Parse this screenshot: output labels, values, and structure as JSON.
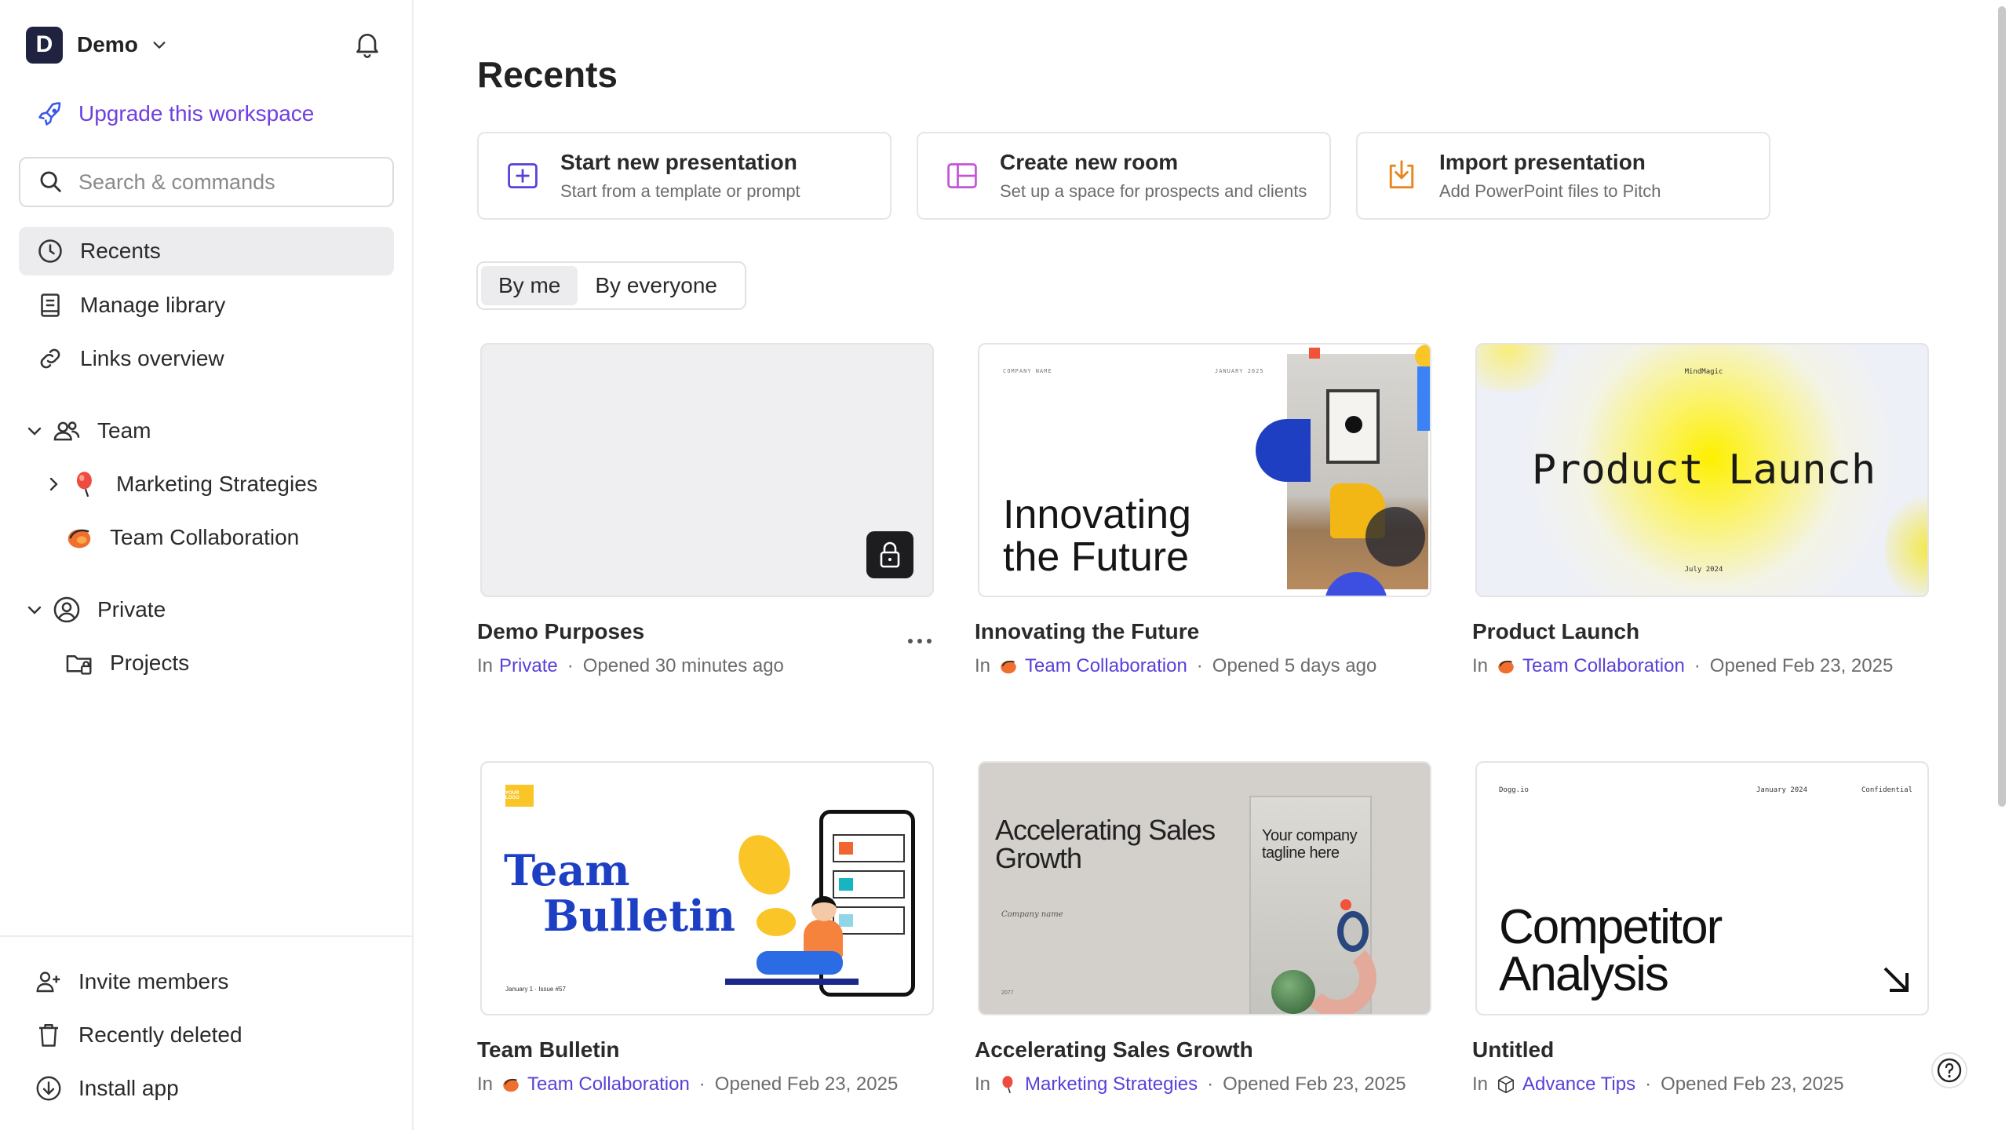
{
  "workspace": {
    "initial": "D",
    "name": "Demo"
  },
  "sidebar": {
    "upgrade_label": "Upgrade this workspace",
    "search_placeholder": "Search & commands",
    "nav": [
      {
        "label": "Recents"
      },
      {
        "label": "Manage library"
      },
      {
        "label": "Links overview"
      }
    ],
    "team": {
      "label": "Team",
      "children": [
        {
          "label": "Marketing Strategies"
        },
        {
          "label": "Team Collaboration"
        }
      ]
    },
    "private": {
      "label": "Private",
      "children": [
        {
          "label": "Projects"
        }
      ]
    },
    "bottom": [
      {
        "label": "Invite members"
      },
      {
        "label": "Recently deleted"
      },
      {
        "label": "Install app"
      }
    ]
  },
  "main": {
    "title": "Recents",
    "actions": [
      {
        "title": "Start new presentation",
        "subtitle": "Start from a template or prompt"
      },
      {
        "title": "Create new room",
        "subtitle": "Set up a space for prospects and clients"
      },
      {
        "title": "Import presentation",
        "subtitle": "Add PowerPoint files to Pitch"
      }
    ],
    "filter": {
      "by_me": "By me",
      "by_everyone": "By everyone"
    },
    "cards": [
      {
        "title": "Demo Purposes",
        "in": "In",
        "location": "Private",
        "opened": "Opened 30 minutes ago"
      },
      {
        "title": "Innovating the Future",
        "in": "In",
        "location": "Team Collaboration",
        "opened": "Opened 5 days ago",
        "thumb": {
          "company": "COMPANY NAME",
          "date": "JANUARY 2025",
          "headline1": "Innovating",
          "headline2": "the Future"
        }
      },
      {
        "title": "Product Launch",
        "in": "In",
        "location": "Team Collaboration",
        "opened": "Opened Feb 23, 2025",
        "thumb": {
          "brand": "MindMagic",
          "headline": "Product Launch",
          "date": "July 2024"
        }
      },
      {
        "title": "Team Bulletin",
        "in": "In",
        "location": "Team Collaboration",
        "opened": "Opened Feb 23, 2025",
        "thumb": {
          "logo": "YOUR LOGO",
          "headline1": "Team",
          "headline2": "Bulletin",
          "footer": "January 1 · Issue #57"
        }
      },
      {
        "title": "Accelerating Sales Growth",
        "in": "In",
        "location": "Marketing Strategies",
        "opened": "Opened Feb 23, 2025",
        "thumb": {
          "headline": "Accelerating Sales Growth",
          "company": "Company name",
          "tagline": "Your company tagline here",
          "year": "2077"
        }
      },
      {
        "title": "Untitled",
        "in": "In",
        "location": "Advance Tips",
        "opened": "Opened Feb 23, 2025",
        "thumb": {
          "brand": "Dogg.io",
          "date": "January 2024",
          "label": "Confidential",
          "headline1": "Competitor",
          "headline2": "Analysis"
        }
      }
    ]
  },
  "colors": {
    "accent": "#5b3fd8",
    "upgrade": "#6f3fe0",
    "import": "#e8871e",
    "room": "#c257d6"
  }
}
